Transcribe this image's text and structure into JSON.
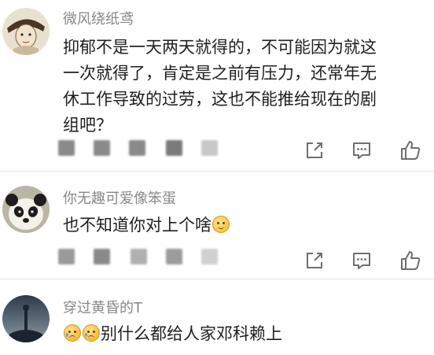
{
  "comments": [
    {
      "username": "微风绕纸鸢",
      "lines": [
        "抑郁不是一天两天就得的，不可能因为就这",
        "一次就得了，肯定是之前有压力，还常年无",
        "休工作导致的过劳，这也不能推给现在的剧",
        "组吧？"
      ]
    },
    {
      "username": "你无趣可爱像笨蛋",
      "text": "也不知道你对上个啥"
    },
    {
      "username": "穿过黄昏的T",
      "text": "别什么都给人家邓科赖上"
    }
  ],
  "icons": {
    "share": "share-icon",
    "comment": "comment-icon",
    "like": "like-icon"
  },
  "colors": {
    "username": "#888888",
    "text": "#1f1f1f",
    "icon": "#6f6f6f",
    "divider": "#e6e6e6"
  }
}
